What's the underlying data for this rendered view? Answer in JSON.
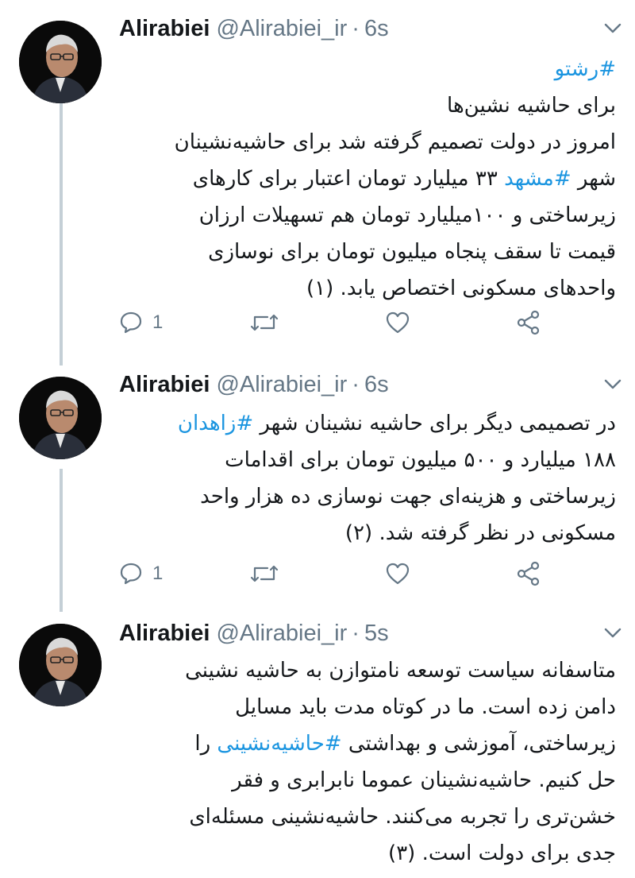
{
  "tweets": [
    {
      "name": "Alirabiei",
      "handle": "@Alirabiei_ir",
      "separator": "·",
      "time": "6s",
      "reply_count": "1",
      "lines": [
        [
          {
            "t": "#رشتو",
            "h": true
          }
        ],
        [
          {
            "t": "برای حاشیه نشین‌ها",
            "h": false
          }
        ],
        [
          {
            "t": "امروز در دولت تصمیم گرفته شد برای حاشیه‌نشینان",
            "h": false
          }
        ],
        [
          {
            "t": "شهر ",
            "h": false
          },
          {
            "t": "#مشهد",
            "h": true
          },
          {
            "t": " ۳۳ میلیارد تومان اعتبار برای کارهای",
            "h": false
          }
        ],
        [
          {
            "t": "زیرساختی و ۱۰۰میلیارد تومان هم تسهیلات ارزان",
            "h": false
          }
        ],
        [
          {
            "t": "قیمت تا سقف پنجاه میلیون تومان برای نوسازی",
            "h": false
          }
        ],
        [
          {
            "t": "واحدهای مسکونی اختصاص یابد. (۱)",
            "h": false
          }
        ]
      ]
    },
    {
      "name": "Alirabiei",
      "handle": "@Alirabiei_ir",
      "separator": "·",
      "time": "6s",
      "reply_count": "1",
      "lines": [
        [
          {
            "t": "در تصمیمی دیگر برای حاشیه نشینان شهر ",
            "h": false
          },
          {
            "t": "#زاهدان",
            "h": true
          }
        ],
        [
          {
            "t": "۱۸۸ میلیارد و ۵۰۰ میلیون تومان برای اقدامات",
            "h": false
          }
        ],
        [
          {
            "t": "زیرساختی و هزینه‌ای جهت نوسازی ده هزار واحد",
            "h": false
          }
        ],
        [
          {
            "t": "مسکونی در نظر گرفته شد. (۲)",
            "h": false
          }
        ]
      ]
    },
    {
      "name": "Alirabiei",
      "handle": "@Alirabiei_ir",
      "separator": "·",
      "time": "5s",
      "lines": [
        [
          {
            "t": "متاسفانه سیاست توسعه نامتوازن به حاشیه نشینی",
            "h": false
          }
        ],
        [
          {
            "t": "دامن زده است. ما در کوتاه مدت باید مسایل",
            "h": false
          }
        ],
        [
          {
            "t": "زیرساختی، آموزشی و بهداشتی ",
            "h": false
          },
          {
            "t": "#حاشیه‌نشینی",
            "h": true
          },
          {
            "t": " را",
            "h": false
          }
        ],
        [
          {
            "t": "حل کنیم. حاشیه‌نشینان عموما نابرابری و فقر",
            "h": false
          }
        ],
        [
          {
            "t": "خشن‌تری را تجربه می‌کنند. حاشیه‌نشینی مسئله‌ای",
            "h": false
          }
        ],
        [
          {
            "t": "جدی برای دولت است. (۳)",
            "h": false
          }
        ]
      ]
    }
  ],
  "icons": {
    "reply": "reply-icon",
    "retweet": "retweet-icon",
    "like": "heart-icon",
    "share": "share-icon",
    "caret": "chevron-down-icon",
    "avatar": "avatar"
  },
  "colors": {
    "hashtag": "#1b95e0",
    "secondary_text": "#657786",
    "thread_line": "#c4cfd6",
    "icon": "#657786"
  }
}
